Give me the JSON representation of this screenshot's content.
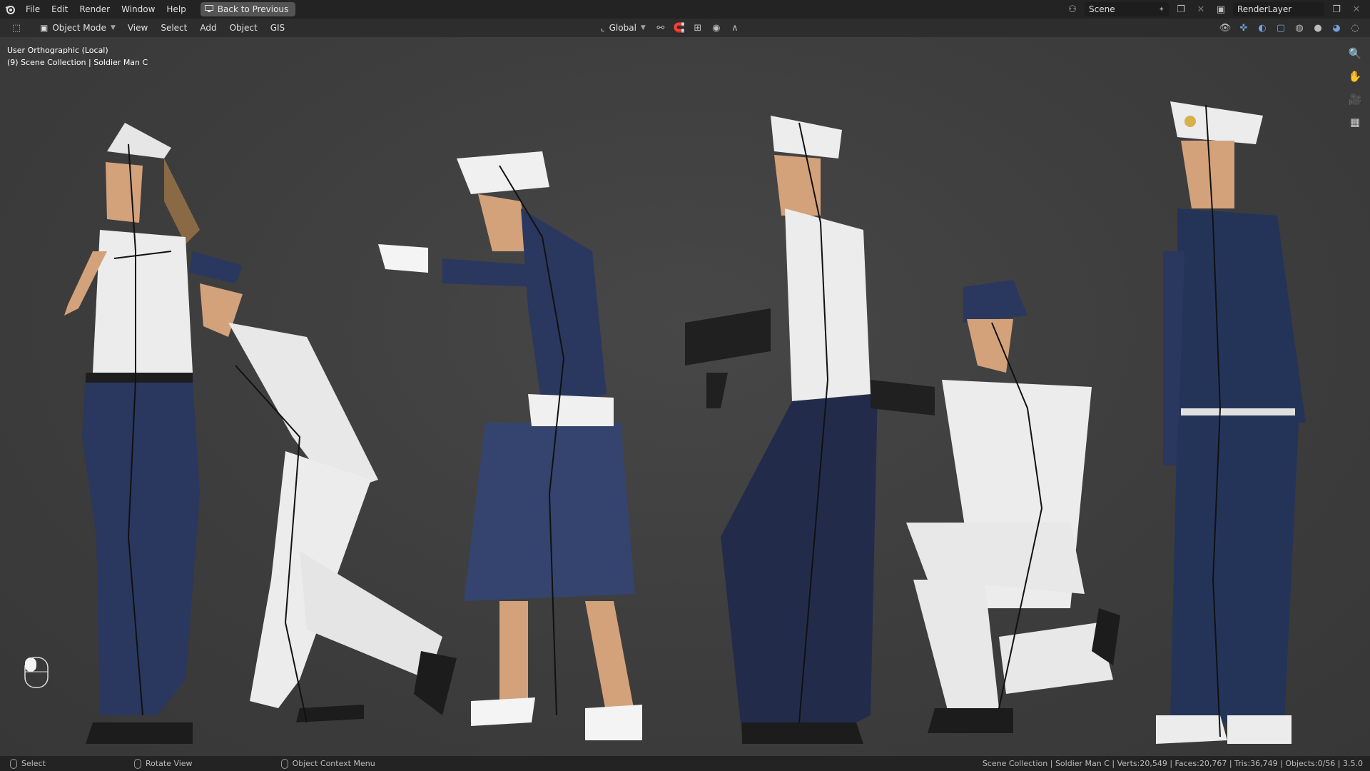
{
  "menubar": {
    "items": [
      "File",
      "Edit",
      "Render",
      "Window",
      "Help"
    ],
    "back_button": "Back to Previous",
    "scene_name": "Scene",
    "render_layer": "RenderLayer"
  },
  "viewport_header": {
    "mode": "Object Mode",
    "menus": [
      "View",
      "Select",
      "Add",
      "Object",
      "GIS"
    ],
    "transform_orientation": "Global"
  },
  "viewport": {
    "view_name": "User Orthographic (Local)",
    "collection_info": "(9) Scene Collection | Soldier Man C",
    "characters": [
      {
        "label": "female-officer-white-shirt"
      },
      {
        "label": "bending-sailor-white"
      },
      {
        "label": "female-officer-aiming-pistol"
      },
      {
        "label": "sailor-with-rifle"
      },
      {
        "label": "kneeling-sailor-aiming"
      },
      {
        "label": "officer-navy-uniform"
      }
    ]
  },
  "statusbar": {
    "hints": [
      "Select",
      "Rotate View",
      "Object Context Menu"
    ],
    "stats": "Scene Collection | Soldier Man C | Verts:20,549 | Faces:20,767 | Tris:36,749 | Objects:0/56 | 3.5.0"
  },
  "colors": {
    "navy": "#2b3a66",
    "white_uniform": "#e8e8e8",
    "skin": "#d2a07a",
    "accent_teal": "#3bc6c6"
  }
}
